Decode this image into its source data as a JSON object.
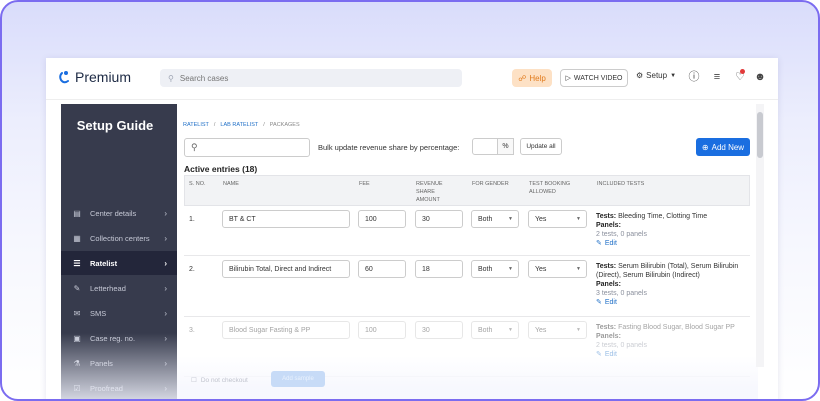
{
  "app": {
    "name": "Premium"
  },
  "topbar": {
    "search_placeholder": "Search cases",
    "help_label": "Help",
    "watch_label": "WATCH VIDEO",
    "setup_label": "Setup",
    "icons": [
      "help-circle-icon",
      "list-icon",
      "bell-icon",
      "user-icon"
    ]
  },
  "sidebar": {
    "title": "Setup Guide",
    "items": [
      {
        "label": "Center details",
        "icon": "building-icon"
      },
      {
        "label": "Collection centers",
        "icon": "collection-icon"
      },
      {
        "label": "Ratelist",
        "icon": "list-icon",
        "active": true
      },
      {
        "label": "Letterhead",
        "icon": "letterhead-icon"
      },
      {
        "label": "SMS",
        "icon": "chat-icon"
      },
      {
        "label": "Case reg. no.",
        "icon": "hash-icon"
      },
      {
        "label": "Panels",
        "icon": "flask-icon"
      },
      {
        "label": "Proofread",
        "icon": "proofread-icon"
      }
    ]
  },
  "breadcrumb": [
    "RATELIST",
    "LAB RATELIST",
    "PACKAGES"
  ],
  "toolbar": {
    "bulk_label": "Bulk update revenue share by percentage:",
    "percent_suffix": "%",
    "update_all_label": "Update all",
    "add_new_label": "Add New"
  },
  "table": {
    "heading": "Active entries (18)",
    "columns": {
      "sno": "S. NO.",
      "name": "NAME",
      "fee": "FEE",
      "revenue": [
        "REVENUE",
        "SHARE",
        "AMOUNT"
      ],
      "gender": "FOR GENDER",
      "booking": [
        "TEST BOOKING",
        "ALLOWED"
      ],
      "tests": "INCLUDED TESTS"
    },
    "rows": [
      {
        "sno": "1.",
        "name": "BT & CT",
        "fee": "100",
        "revenue": "30",
        "gender": "Both",
        "booking": "Yes",
        "tests_label": "Tests:",
        "tests": "Bleeding Time, Clotting Time",
        "panels_label": "Panels:",
        "summary": "2 tests, 0 panels",
        "edit": "Edit"
      },
      {
        "sno": "2.",
        "name": "Bilirubin Total, Direct and Indirect",
        "fee": "60",
        "revenue": "18",
        "gender": "Both",
        "booking": "Yes",
        "tests_label": "Tests:",
        "tests": "Serum Bilirubin (Total), Serum Bilirubin (Direct), Serum Bilirubin (Indirect)",
        "panels_label": "Panels:",
        "summary": "3 tests, 0 panels",
        "edit": "Edit"
      },
      {
        "sno": "3.",
        "name": "Blood Sugar Fasting & PP",
        "fee": "100",
        "revenue": "30",
        "gender": "Both",
        "booking": "Yes",
        "tests_label": "Tests:",
        "tests": "Fasting Blood Sugar, Blood Sugar PP",
        "panels_label": "Panels:",
        "summary": "2 tests, 0 panels",
        "edit": "Edit"
      }
    ]
  },
  "footer": {
    "checkbox_label": "Do not checkout",
    "button_label": "Add sample"
  },
  "colors": {
    "accent": "#1a6ee0",
    "sidebar": "#373b4d",
    "sidebar_active": "#23263a",
    "help": "#e17a1b",
    "frame_border": "#7b6cf0"
  }
}
